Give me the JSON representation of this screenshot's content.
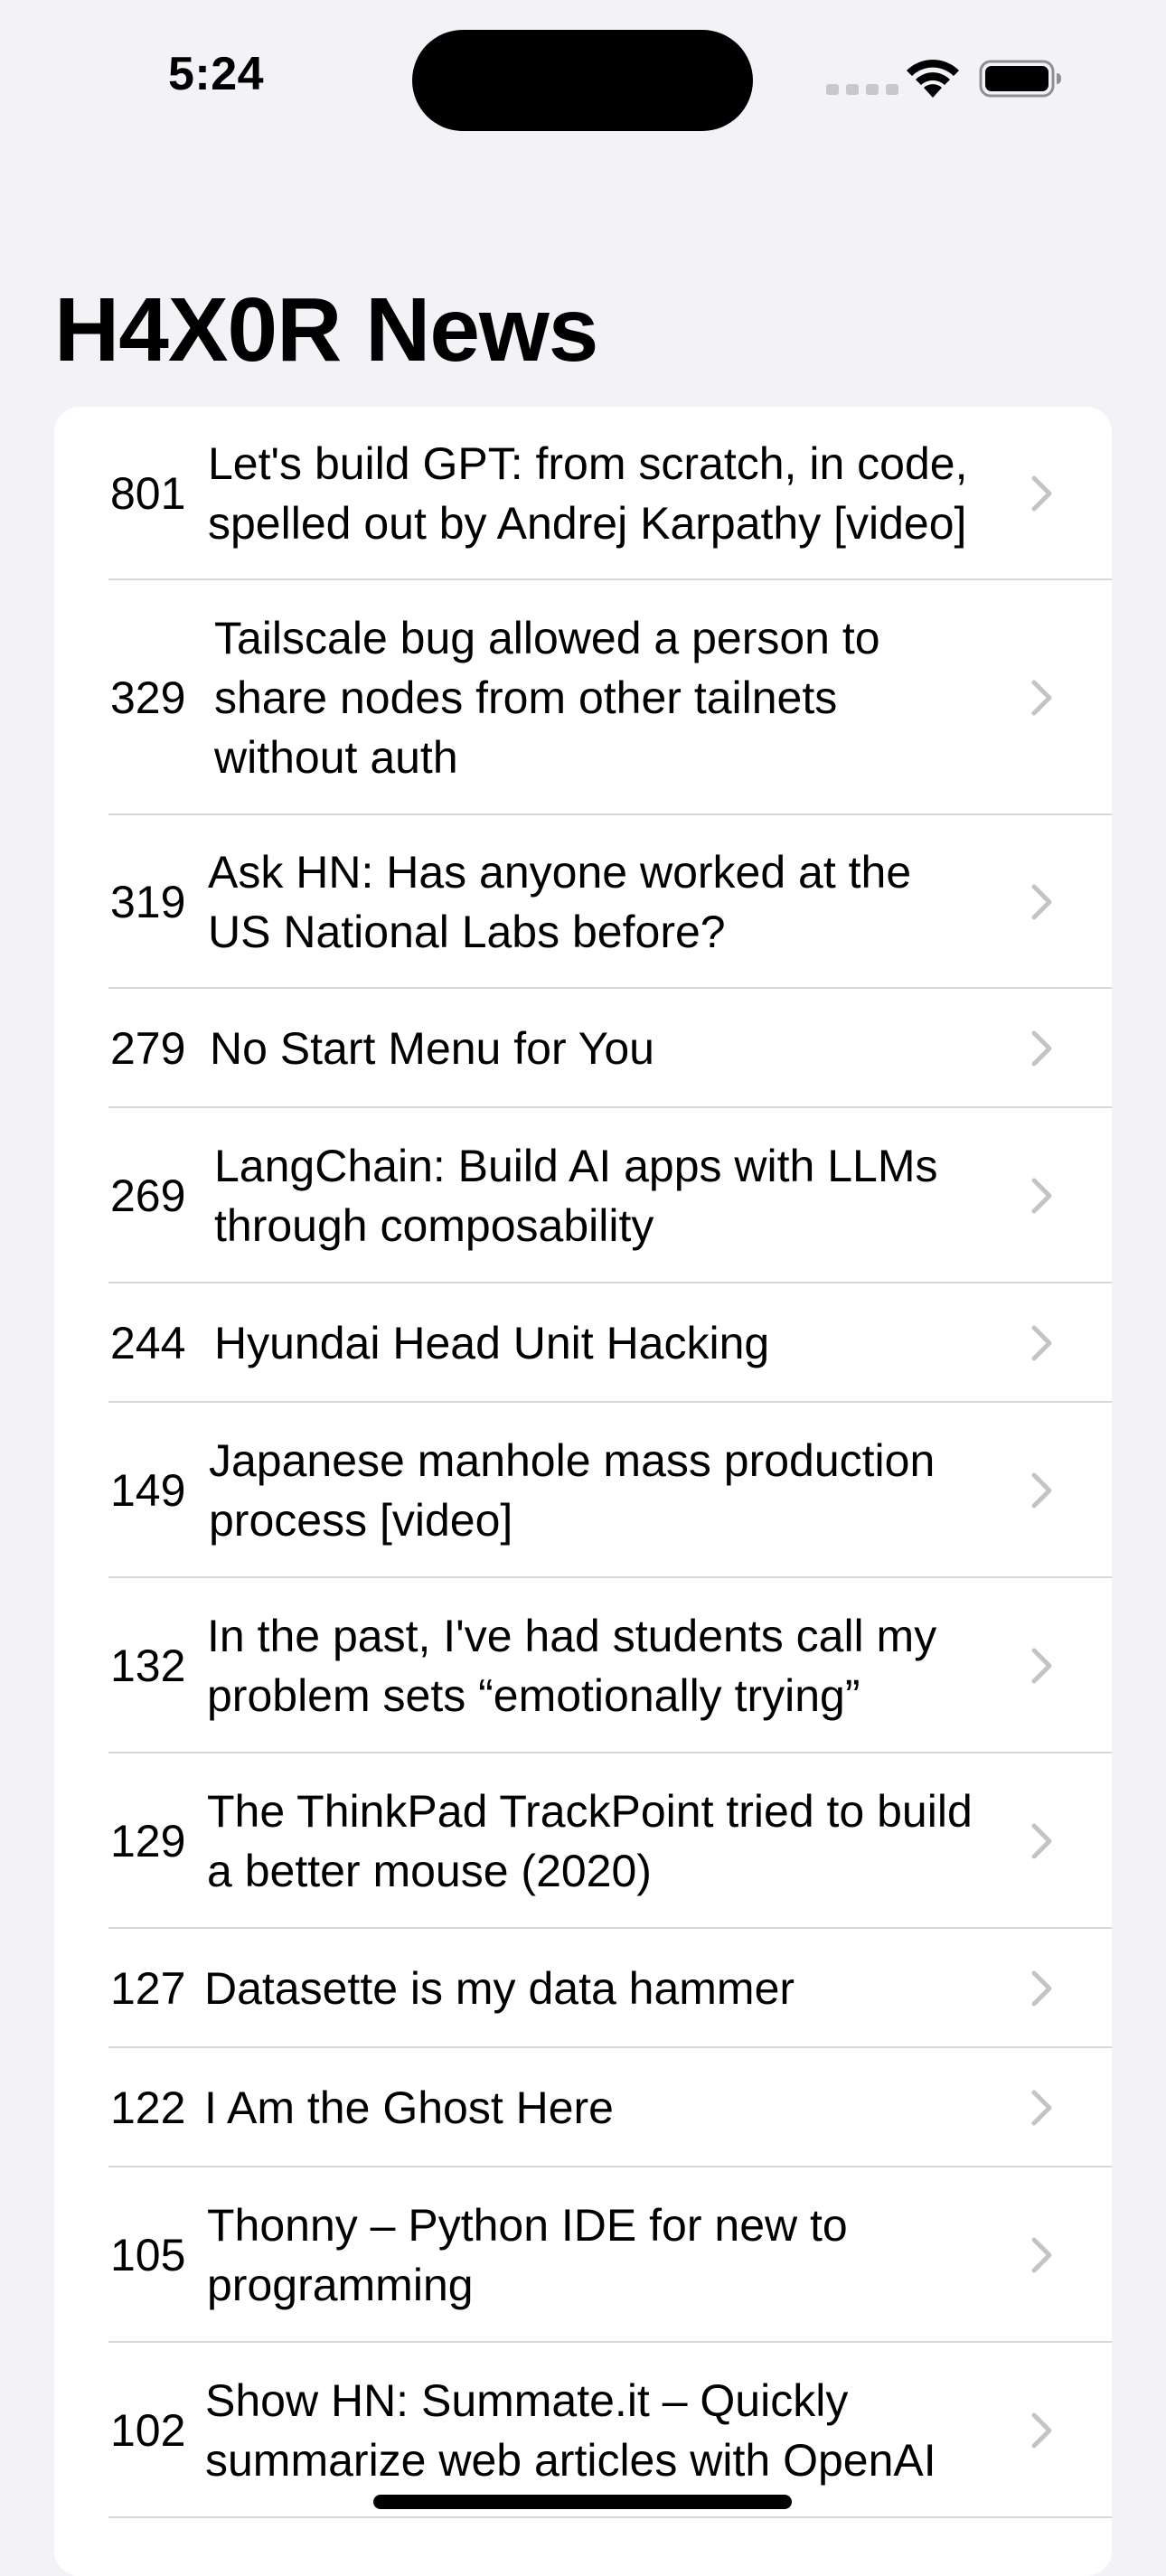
{
  "status_bar": {
    "time": "5:24"
  },
  "nav": {
    "title": "H4X0R News"
  },
  "stories": [
    {
      "score": "801",
      "title": "Let's build GPT: from scratch, in code, spelled out by Andrej Karpathy [video]"
    },
    {
      "score": "329",
      "title": "Tailscale bug allowed a person to share nodes from other tailnets without auth"
    },
    {
      "score": "319",
      "title": "Ask HN: Has anyone worked at the US National Labs before?"
    },
    {
      "score": "279",
      "title": "No Start Menu for You"
    },
    {
      "score": "269",
      "title": "LangChain: Build AI apps with LLMs through composability"
    },
    {
      "score": "244",
      "title": "Hyundai Head Unit Hacking"
    },
    {
      "score": "149",
      "title": "Japanese manhole mass production process [video]"
    },
    {
      "score": "132",
      "title": "In the past, I've had students call my problem sets “emotionally trying”"
    },
    {
      "score": "129",
      "title": "The ThinkPad TrackPoint tried to build a better mouse (2020)"
    },
    {
      "score": "127",
      "title": "Datasette is my data hammer"
    },
    {
      "score": "122",
      "title": "I Am the Ghost Here"
    },
    {
      "score": "105",
      "title": "Thonny – Python IDE for new to programming"
    },
    {
      "score": "102",
      "title": "Show HN: Summate.it – Quickly summarize web articles with OpenAI"
    }
  ],
  "icons": {
    "wifi": "wifi-icon",
    "battery": "battery-icon",
    "chevron": "chevron-right-icon"
  },
  "colors": {
    "background": "#f2f2f7",
    "card": "#ffffff",
    "separator": "#d8d8dc",
    "chevron": "#c4c4c7"
  }
}
